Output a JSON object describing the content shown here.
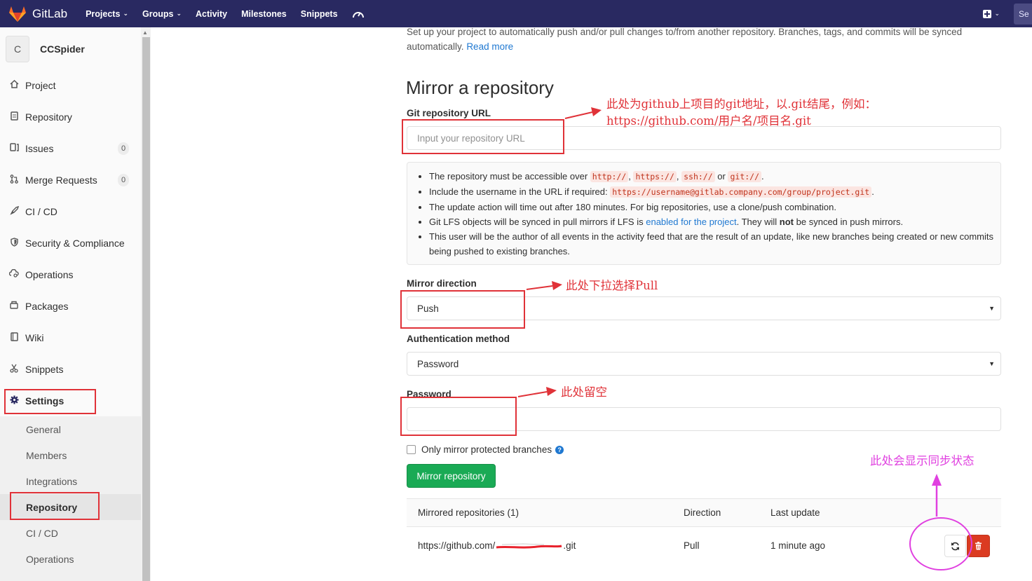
{
  "topnav": {
    "brand": "GitLab",
    "items": [
      {
        "label": "Projects",
        "dropdown": true
      },
      {
        "label": "Groups",
        "dropdown": true
      },
      {
        "label": "Activity",
        "dropdown": false
      },
      {
        "label": "Milestones",
        "dropdown": false
      },
      {
        "label": "Snippets",
        "dropdown": false
      }
    ],
    "search_stub": "Se",
    "colors": {
      "nav_bg": "#292961",
      "brand_orange": "#fc6d26"
    }
  },
  "sidebar": {
    "project_initial": "C",
    "project_name": "CCSpider",
    "items": [
      {
        "label": "Project",
        "icon": "home-icon"
      },
      {
        "label": "Repository",
        "icon": "document-icon"
      },
      {
        "label": "Issues",
        "icon": "issues-icon",
        "count": "0"
      },
      {
        "label": "Merge Requests",
        "icon": "merge-request-icon",
        "count": "0"
      },
      {
        "label": "CI / CD",
        "icon": "rocket-icon"
      },
      {
        "label": "Security & Compliance",
        "icon": "shield-icon"
      },
      {
        "label": "Operations",
        "icon": "cloud-gear-icon"
      },
      {
        "label": "Packages",
        "icon": "package-icon"
      },
      {
        "label": "Wiki",
        "icon": "book-icon"
      },
      {
        "label": "Snippets",
        "icon": "scissors-icon"
      },
      {
        "label": "Settings",
        "icon": "gear-icon",
        "active": true
      }
    ],
    "settings_sub": [
      "General",
      "Members",
      "Integrations",
      "Repository",
      "CI / CD",
      "Operations"
    ],
    "active_sub": "Repository"
  },
  "main": {
    "intro": "Set up your project to automatically push and/or pull changes to/from another repository. Branches, tags, and commits will be synced automatically.",
    "read_more": "Read more",
    "title": "Mirror a repository",
    "url_label": "Git repository URL",
    "url_placeholder": "Input your repository URL",
    "info": {
      "l1_pre": "The repository must be accessible over",
      "protocols": [
        "http://",
        "https://",
        "ssh://",
        "git://"
      ],
      "or": "or",
      "l2_pre": "Include the username in the URL if required:",
      "l2_code": "https://username@gitlab.company.com/group/project.git",
      "l3": "The update action will time out after 180 minutes. For big repositories, use a clone/push combination.",
      "l4_pre": "Git LFS objects will be synced in pull mirrors if LFS is",
      "l4_link": "enabled for the project",
      "l4_mid": ". They will",
      "l4_bold": "not",
      "l4_post": "be synced in push mirrors.",
      "l5": "This user will be the author of all events in the activity feed that are the result of an update, like new branches being created or new commits being pushed to existing branches."
    },
    "direction_label": "Mirror direction",
    "direction_value": "Push",
    "auth_label": "Authentication method",
    "auth_value": "Password",
    "password_label": "Password",
    "password_value": "",
    "checkbox_label": "Only mirror protected branches",
    "mirror_button": "Mirror repository",
    "table": {
      "headers": [
        "Mirrored repositories (1)",
        "Direction",
        "Last update"
      ],
      "rows": [
        {
          "url_start": "https://github.com/",
          "url_end": ".git",
          "direction": "Pull",
          "last_update": "1 minute ago"
        }
      ]
    },
    "colors": {
      "primary_green": "#1aaa55",
      "danger_red": "#db3b21",
      "link_blue": "#1f78d1"
    }
  },
  "annotations": {
    "url_note_line1": "此处为github上项目的git地址，以.git结尾，例如：",
    "url_note_line2": "https://github.com/用户名/项目名.git",
    "direction_note": "此处下拉选择Pull",
    "password_note": "此处留空",
    "status_note": "此处会显示同步状态",
    "colors": {
      "red": "#e03238",
      "magenta": "#e040e0"
    }
  }
}
